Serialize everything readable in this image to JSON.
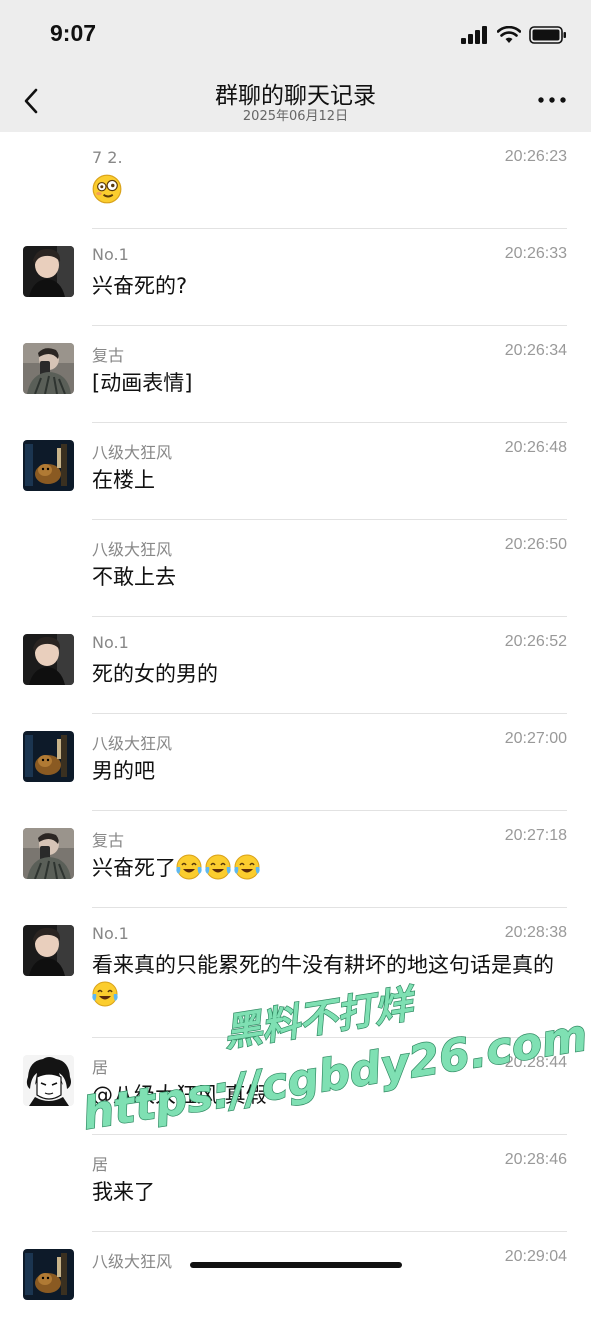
{
  "status_bar": {
    "time": "9:07"
  },
  "header": {
    "title": "群聊的聊天记录",
    "date": "2025年06月12日"
  },
  "messages": [
    {
      "sender": "7 2.",
      "time": "20:26:23",
      "text": "",
      "emojis": [
        "dizzy-face"
      ]
    },
    {
      "sender": "No.1",
      "time": "20:26:33",
      "text": "兴奋死的?"
    },
    {
      "sender": "复古",
      "time": "20:26:34",
      "text": "[动画表情]"
    },
    {
      "sender": "八级大狂风",
      "time": "20:26:48",
      "text": "在楼上"
    },
    {
      "sender": "八级大狂风",
      "time": "20:26:50",
      "text": "不敢上去"
    },
    {
      "sender": "No.1",
      "time": "20:26:52",
      "text": "死的女的男的"
    },
    {
      "sender": "八级大狂风",
      "time": "20:27:00",
      "text": "男的吧"
    },
    {
      "sender": "复古",
      "time": "20:27:18",
      "text": "兴奋死了",
      "emojis": [
        "laughing-tears",
        "laughing-tears",
        "laughing-tears"
      ]
    },
    {
      "sender": "No.1",
      "time": "20:28:38",
      "text": "看来真的只能累死的牛没有耕坏的地这句话是真的",
      "emojis": [
        "laughing-tears"
      ]
    },
    {
      "sender": "居",
      "time": "20:28:44",
      "text": "@八级大狂风 真假"
    },
    {
      "sender": "居",
      "time": "20:28:46",
      "text": "我来了"
    },
    {
      "sender": "八级大狂风",
      "time": "20:29:04",
      "text": ""
    }
  ],
  "watermark": {
    "line1": "黑料不打烊",
    "line2": "https://cgbdy26.com",
    "color": "#7fe0b3"
  }
}
